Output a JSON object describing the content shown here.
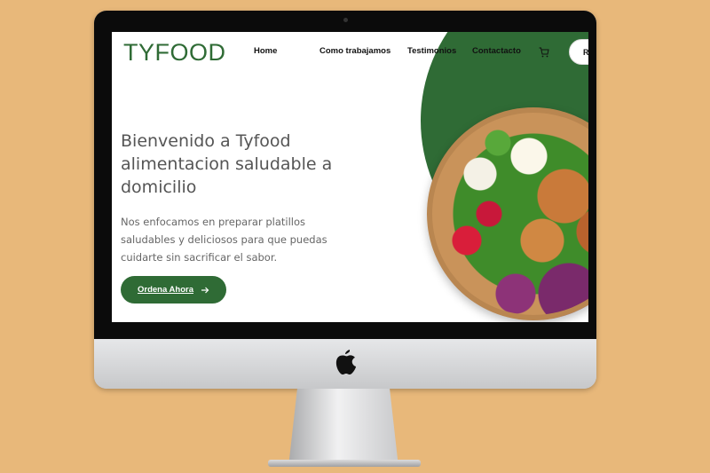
{
  "site": {
    "logo": "TYFOOD",
    "nav": [
      {
        "label": "Home"
      },
      {
        "label": "Como trabajamos"
      },
      {
        "label": "Testimonios"
      },
      {
        "label": "Contactacto"
      }
    ],
    "cart_icon": "shopping-cart-icon",
    "cta_partial": "R"
  },
  "hero": {
    "title": "Bienvenido a Tyfood alimentacion saludable a domicilio",
    "description": "Nos enfocamos en preparar platillos saludables y deliciosos para que puedas cuidarte sin sacrificar el sabor.",
    "button_label": "Ordena Ahora",
    "button_icon": "arrow-right-icon"
  },
  "colors": {
    "brand_green": "#2f6b35",
    "background": "#e8b87a"
  }
}
